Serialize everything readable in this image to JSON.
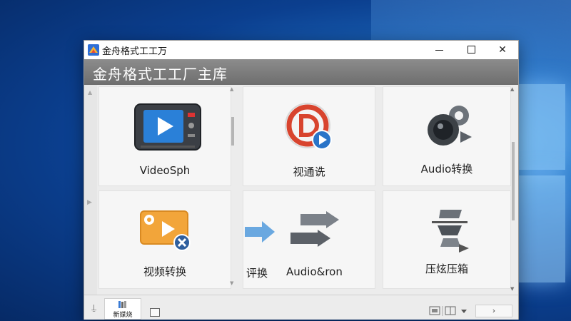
{
  "window": {
    "title": "金舟格式工工万",
    "header_title": "金舟格式工工厂主库",
    "min_label": "",
    "close_label": "✕"
  },
  "tiles": [
    {
      "label": "VideoSph",
      "icon": "video-player-icon"
    },
    {
      "label": "视通诜",
      "icon": "d-logo-play-icon"
    },
    {
      "label": "Audio转换",
      "icon": "speaker-gear-icon"
    },
    {
      "label": "视频转换",
      "icon": "video-settings-close-icon"
    },
    {
      "label": "评换",
      "icon": "right-arrow-icon"
    },
    {
      "label": "Audio&ron",
      "icon": "convert-arrows-icon"
    },
    {
      "label": "压炫压箱",
      "icon": "compress-icon"
    }
  ],
  "statusbar": {
    "tab_label": "新媒烧",
    "next_label": "›"
  },
  "colors": {
    "header": "#7d7d7d",
    "desktop": "#0b3f8f",
    "play_blue": "#1e88e5",
    "accent_orange": "#f0a030"
  }
}
